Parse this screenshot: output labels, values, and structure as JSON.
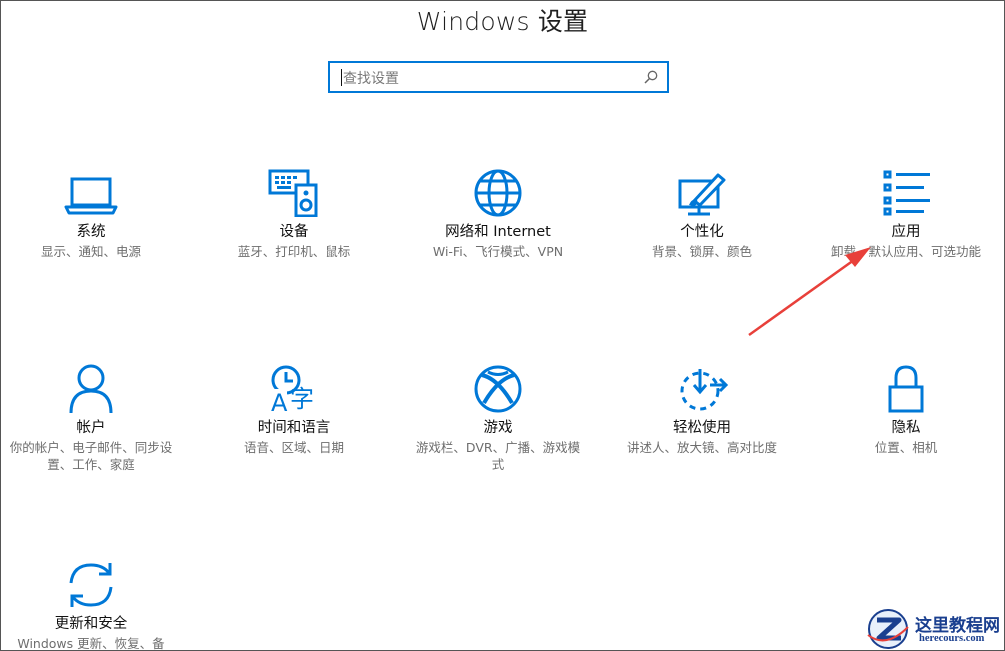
{
  "window": {
    "title": "Windows 设置"
  },
  "search": {
    "placeholder": "查找设置"
  },
  "tiles": [
    {
      "name": "系统",
      "desc": "显示、通知、电源",
      "icon": "laptop-icon"
    },
    {
      "name": "设备",
      "desc": "蓝牙、打印机、鼠标",
      "icon": "devices-icon"
    },
    {
      "name": "网络和 Internet",
      "desc": "Wi-Fi、飞行模式、VPN",
      "icon": "globe-icon"
    },
    {
      "name": "个性化",
      "desc": "背景、锁屏、颜色",
      "icon": "paintbrush-icon"
    },
    {
      "name": "应用",
      "desc": "卸载、默认应用、可选功能",
      "icon": "apps-list-icon"
    },
    {
      "name": "帐户",
      "desc": "你的帐户、电子邮件、同步设置、工作、家庭",
      "icon": "person-icon"
    },
    {
      "name": "时间和语言",
      "desc": "语音、区域、日期",
      "icon": "time-language-icon"
    },
    {
      "name": "游戏",
      "desc": "游戏栏、DVR、广播、游戏模式",
      "icon": "xbox-icon"
    },
    {
      "name": "轻松使用",
      "desc": "讲述人、放大镜、高对比度",
      "icon": "ease-of-access-icon"
    },
    {
      "name": "隐私",
      "desc": "位置、相机",
      "icon": "lock-icon"
    },
    {
      "name": "更新和安全",
      "desc": "Windows 更新、恢复、备",
      "icon": "sync-icon"
    }
  ],
  "watermark": {
    "title": "这里教程网",
    "url": "herecours.com"
  },
  "colors": {
    "accent": "#0078d7",
    "arrow": "#e8403a"
  }
}
